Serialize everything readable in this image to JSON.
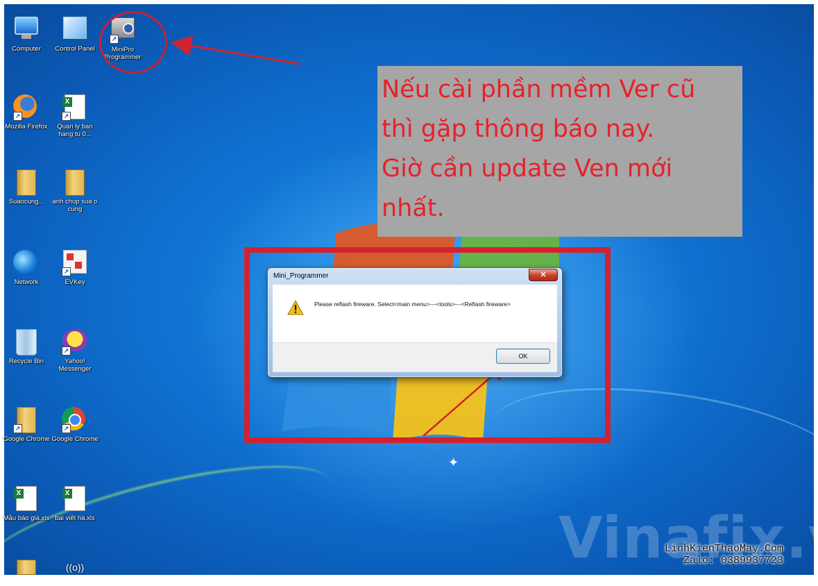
{
  "desktop_icons": [
    {
      "label": "Computer"
    },
    {
      "label": "Control Panel"
    },
    {
      "label": "MiniPro Programmer"
    },
    {
      "label": "Mozilla Firefox"
    },
    {
      "label": "Quan ly ban hang tu 0..."
    },
    {
      "label": "Suaocung..."
    },
    {
      "label": "anh chup sua o cung"
    },
    {
      "label": "Network"
    },
    {
      "label": "EVKey"
    },
    {
      "label": "Recycle Bin"
    },
    {
      "label": "Yahoo! Messenger"
    },
    {
      "label": "Google Chrome"
    },
    {
      "label": "Google Chrome"
    },
    {
      "label": "Mẫu báo giá.xls"
    },
    {
      "label": "bai viết hà.xls"
    },
    {
      "label": ""
    },
    {
      "label": "((o))"
    }
  ],
  "note": {
    "lines": [
      "Nếu cài phần mềm Ver cũ",
      "thì gặp thông báo nay.",
      "Giờ cần update Ven mới",
      "nhất."
    ],
    "text_color": "#e8202a",
    "background": "#a6a6a6"
  },
  "dialog": {
    "title": "Mini_Programmer",
    "close_label": "✕",
    "message": "Please reflash fireware. Select<main menu>---<tools>---<Reflash fireware>",
    "ok_label": "OK"
  },
  "watermark": {
    "brand": "Vinafix.vn",
    "site": "LinhKienThaoMay.Com",
    "zalo": "Zalo: 0389937723"
  },
  "annotation_color": "#d3222f"
}
